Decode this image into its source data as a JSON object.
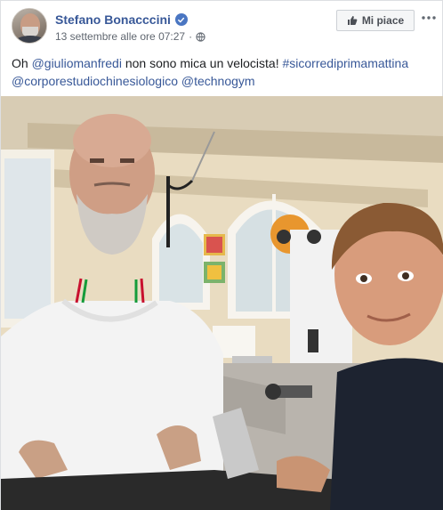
{
  "post": {
    "author": "Stefano Bonacccini",
    "timestamp": "13 settembre alle ore 07:27",
    "separator": "·",
    "like_button_label": "Mi piace",
    "text": {
      "line1": {
        "prefix": "Oh ",
        "mention_1": "@giuliomanfredi",
        "middle": " non sono mica un velocista! ",
        "hashtag": "#sicorrediprimamattina"
      },
      "line2": {
        "mention_2": "@corporestudiochinesiologico",
        "space": " ",
        "mention_3": "@technogym"
      }
    }
  },
  "colors": {
    "link": "#385898",
    "meta_text": "#606770",
    "body_text": "#1c1e21",
    "button_bg": "#f5f6f7"
  },
  "icons": {
    "verified": "verified-badge-icon",
    "audience": "globe-icon",
    "like": "thumbs-up-icon",
    "more": "more-options-icon"
  }
}
